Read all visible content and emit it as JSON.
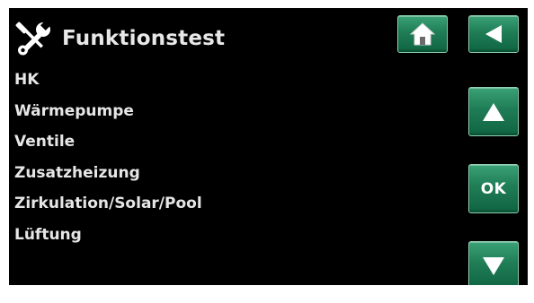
{
  "header": {
    "title": "Funktionstest",
    "icon": "tools-icon"
  },
  "menu": {
    "items": [
      {
        "label": "HK"
      },
      {
        "label": "Wärmepumpe"
      },
      {
        "label": "Ventile"
      },
      {
        "label": "Zusatzheizung"
      },
      {
        "label": "Zirkulation/Solar/Pool"
      },
      {
        "label": "Lüftung"
      }
    ]
  },
  "buttons": {
    "home_icon": "home-icon",
    "back_icon": "arrow-left-icon",
    "up_icon": "arrow-up-icon",
    "ok_label": "OK",
    "down_icon": "arrow-down-icon"
  },
  "colors": {
    "background": "#000000",
    "text": "#e6e6e6",
    "button_green": "#1f7d56",
    "button_border": "#8fd3b2"
  }
}
